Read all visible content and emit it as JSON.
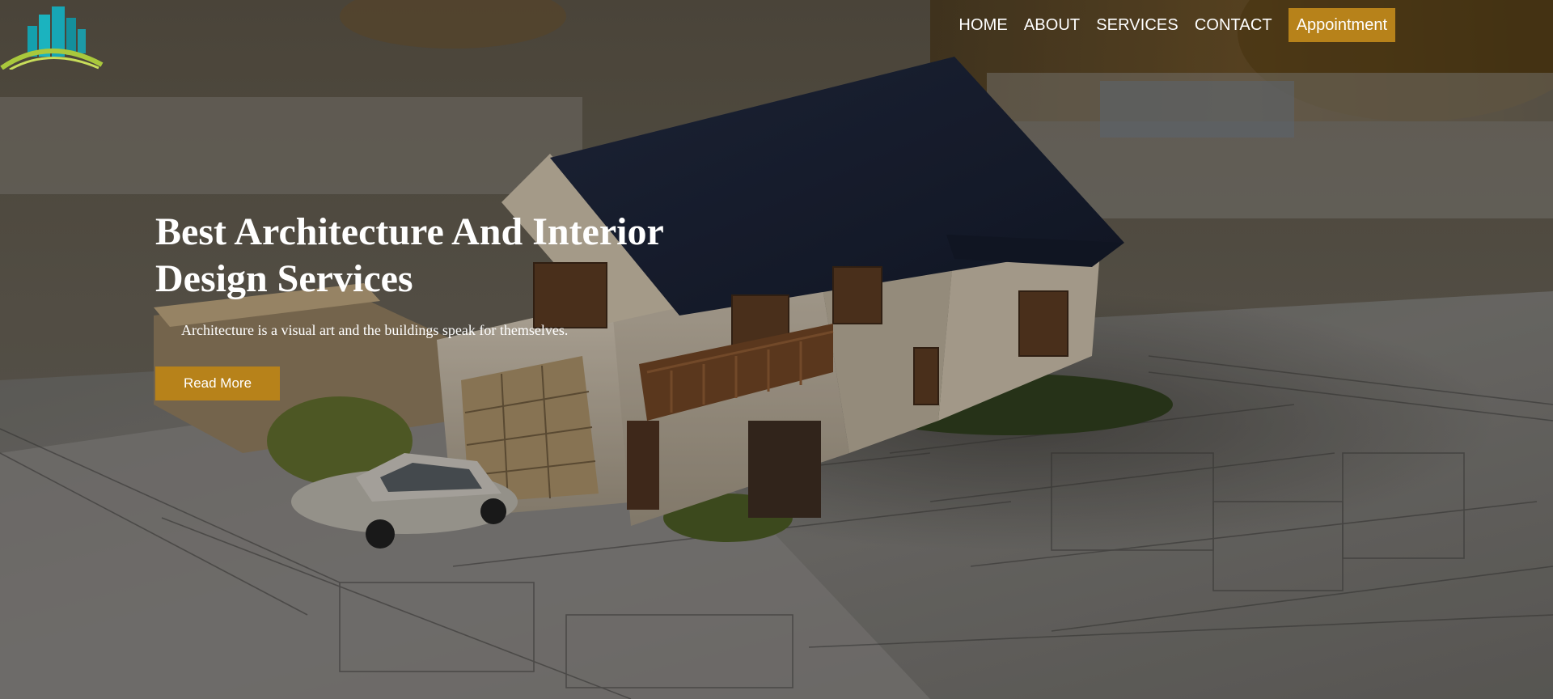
{
  "nav": {
    "items": [
      {
        "label": "HOME"
      },
      {
        "label": "ABOUT"
      },
      {
        "label": "SERVICES"
      },
      {
        "label": "CONTACT"
      }
    ],
    "appointment_label": "Appointment"
  },
  "hero": {
    "title": "Best Architecture And Interior Design Services",
    "subtitle": "Architecture is a visual art and the buildings speak for themselves.",
    "cta_label": "Read More",
    "background": "house-model-on-blueprints"
  },
  "logo": {
    "icon": "building-logo-icon"
  },
  "colors": {
    "accent": "#b7821a",
    "text": "#ffffff",
    "roof": "#1e2740",
    "logo_teal": "#17a6b5",
    "logo_green": "#a9c83c"
  }
}
